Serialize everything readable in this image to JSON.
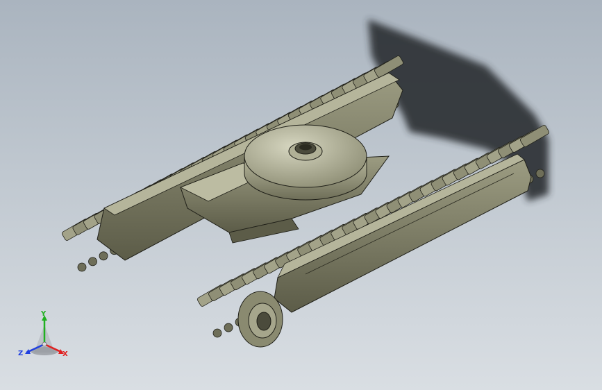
{
  "scene": {
    "description_free": true,
    "model": "crawler-track-undercarriage",
    "colors": {
      "background_top": "#aab4bf",
      "background_bottom": "#d9dee3",
      "part_base": "#8a8a70",
      "part_light": "#c9c9b0",
      "part_dark": "#4b4b3c",
      "edge": "#1f1f18",
      "shadow": "#2b2e33"
    }
  },
  "triad": {
    "x_label": "X",
    "y_label": "Y",
    "z_label": "Z",
    "x_color": "#e02020",
    "y_color": "#20b020",
    "z_color": "#2040e0",
    "icon": "coordinate-triad-icon"
  }
}
